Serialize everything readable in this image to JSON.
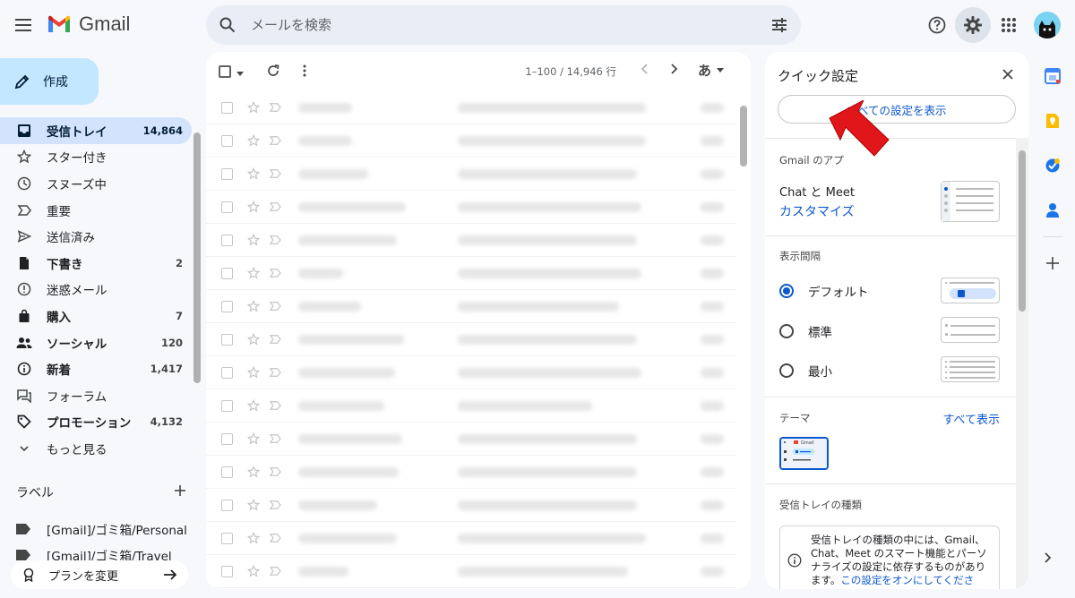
{
  "app": {
    "title": "Gmail"
  },
  "search": {
    "placeholder": "メールを検索"
  },
  "compose": {
    "label": "作成"
  },
  "nav": [
    {
      "label": "受信トレイ",
      "count": "14,864",
      "icon": "inbox-icon",
      "selected": true,
      "bold": true
    },
    {
      "label": "スター付き",
      "count": "",
      "icon": "star-icon"
    },
    {
      "label": "スヌーズ中",
      "count": "",
      "icon": "clock-icon"
    },
    {
      "label": "重要",
      "count": "",
      "icon": "important-icon"
    },
    {
      "label": "送信済み",
      "count": "",
      "icon": "send-icon"
    },
    {
      "label": "下書き",
      "count": "2",
      "icon": "draft-icon",
      "bold": true
    },
    {
      "label": "迷惑メール",
      "count": "",
      "icon": "spam-icon"
    },
    {
      "label": "購入",
      "count": "7",
      "icon": "purchase-icon",
      "bold": true
    },
    {
      "label": "ソーシャル",
      "count": "120",
      "icon": "social-icon",
      "bold": true
    },
    {
      "label": "新着",
      "count": "1,417",
      "icon": "updates-icon",
      "bold": true
    },
    {
      "label": "フォーラム",
      "count": "",
      "icon": "forum-icon"
    },
    {
      "label": "プロモーション",
      "count": "4,132",
      "icon": "tag-icon",
      "bold": true
    },
    {
      "label": "もっと見る",
      "count": "",
      "icon": "chevron-down-icon"
    }
  ],
  "labels": {
    "header": "ラベル",
    "items": [
      "[Gmail]/ゴミ箱/Personal",
      "[Gmail]/ゴミ箱/Travel"
    ]
  },
  "plan": {
    "label": "プランを変更"
  },
  "mail": {
    "pager": "1–100 / 14,946 行",
    "input_tool": "あ",
    "row_count": 15
  },
  "quick_settings": {
    "title": "クイック設定",
    "all_settings": "すべての設定を表示",
    "apps_section": "Gmail のアプ",
    "chat_meet": "Chat と Meet",
    "customize": "カスタマイズ",
    "density_section": "表示間隔",
    "density_options": [
      "デフォルト",
      "標準",
      "最小"
    ],
    "density_selected": 0,
    "theme_section": "テーマ",
    "theme_all": "すべて表示",
    "theme_logo": "Gmail",
    "inbox_type_section": "受信トレイの種類",
    "inbox_info": "受信トレイの種類の中には、Gmail、Chat、Meet のスマート機能とパーソナライズの設定に依存するものがあります。",
    "inbox_info_link": "この設定をオンにしてください。"
  },
  "colors": {
    "accent": "#0b57d0",
    "compose_bg": "#c2e7ff",
    "selected_bg": "#d3e3fd",
    "arrow": "#e0161b",
    "page_bg": "#f6f8fc"
  }
}
